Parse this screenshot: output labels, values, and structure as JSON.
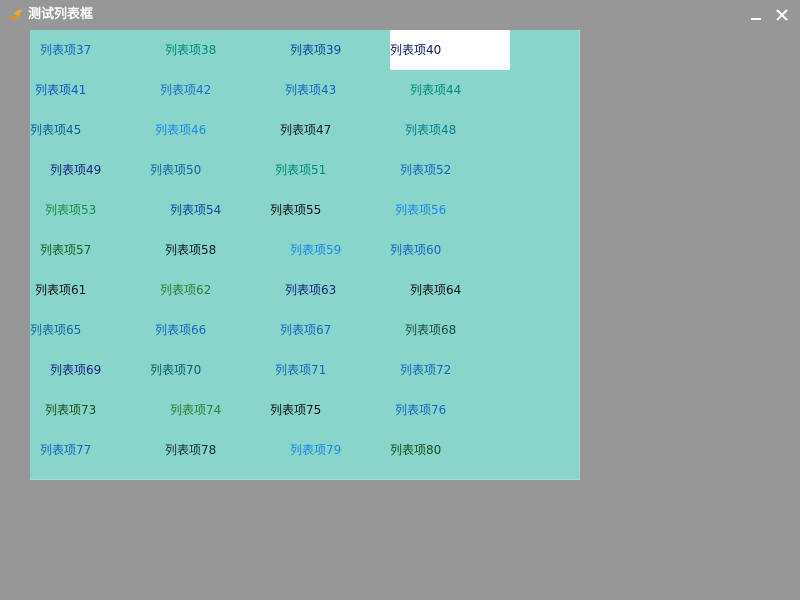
{
  "window": {
    "title": "测试列表框",
    "icon": "app-logo-icon",
    "minimize_icon": "minimize-icon",
    "close_icon": "close-icon"
  },
  "colors": {
    "desktop_background": "#979797",
    "listbox_background": "#87d5cb",
    "selected_background": "#ffffff"
  },
  "listbox": {
    "selected_label": "列表项40",
    "items": [
      {
        "label": "列表项37",
        "color": "#1565c0"
      },
      {
        "label": "列表项38",
        "color": "#00897b"
      },
      {
        "label": "列表项39",
        "color": "#0d47a1"
      },
      {
        "label": "列表项40",
        "color": "#0d1b6b"
      },
      {
        "label": "列表项41",
        "color": "#1556c0"
      },
      {
        "label": "列表项42",
        "color": "#1e6fc8"
      },
      {
        "label": "列表项43",
        "color": "#1565c0"
      },
      {
        "label": "列表项44",
        "color": "#00897b"
      },
      {
        "label": "列表项45",
        "color": "#0b5e9b"
      },
      {
        "label": "列表项46",
        "color": "#1e88e5"
      },
      {
        "label": "列表项47",
        "color": "#1a1a2e"
      },
      {
        "label": "列表项48",
        "color": "#0a7e8c"
      },
      {
        "label": "列表项49",
        "color": "#1a237e"
      },
      {
        "label": "列表项50",
        "color": "#1565a0"
      },
      {
        "label": "列表项51",
        "color": "#00897b"
      },
      {
        "label": "列表项52",
        "color": "#1565c0"
      },
      {
        "label": "列表项53",
        "color": "#1b8a4a"
      },
      {
        "label": "列表项54",
        "color": "#0d47a1"
      },
      {
        "label": "列表项55",
        "color": "#111111"
      },
      {
        "label": "列表项56",
        "color": "#1e88e5"
      },
      {
        "label": "列表项57",
        "color": "#1b5e20"
      },
      {
        "label": "列表项58",
        "color": "#101828"
      },
      {
        "label": "列表项59",
        "color": "#1e88e5"
      },
      {
        "label": "列表项60",
        "color": "#1565c0"
      },
      {
        "label": "列表项61",
        "color": "#111111"
      },
      {
        "label": "列表项62",
        "color": "#2e7d32"
      },
      {
        "label": "列表项63",
        "color": "#1a237e"
      },
      {
        "label": "列表项64",
        "color": "#111111"
      },
      {
        "label": "列表项65",
        "color": "#1565a0"
      },
      {
        "label": "列表项66",
        "color": "#1565c0"
      },
      {
        "label": "列表项67",
        "color": "#1565c0"
      },
      {
        "label": "列表项68",
        "color": "#1b4d3e"
      },
      {
        "label": "列表项69",
        "color": "#1a237e"
      },
      {
        "label": "列表项70",
        "color": "#0b5e6b"
      },
      {
        "label": "列表项71",
        "color": "#1565c0"
      },
      {
        "label": "列表项72",
        "color": "#1565c0"
      },
      {
        "label": "列表项73",
        "color": "#1b4d1e"
      },
      {
        "label": "列表项74",
        "color": "#2e7d32"
      },
      {
        "label": "列表项75",
        "color": "#111111"
      },
      {
        "label": "列表项76",
        "color": "#1565c0"
      },
      {
        "label": "列表项77",
        "color": "#1565c0"
      },
      {
        "label": "列表项78",
        "color": "#1a2a3a"
      },
      {
        "label": "列表项79",
        "color": "#1e88e5"
      },
      {
        "label": "列表项80",
        "color": "#1b4d1e"
      }
    ]
  }
}
